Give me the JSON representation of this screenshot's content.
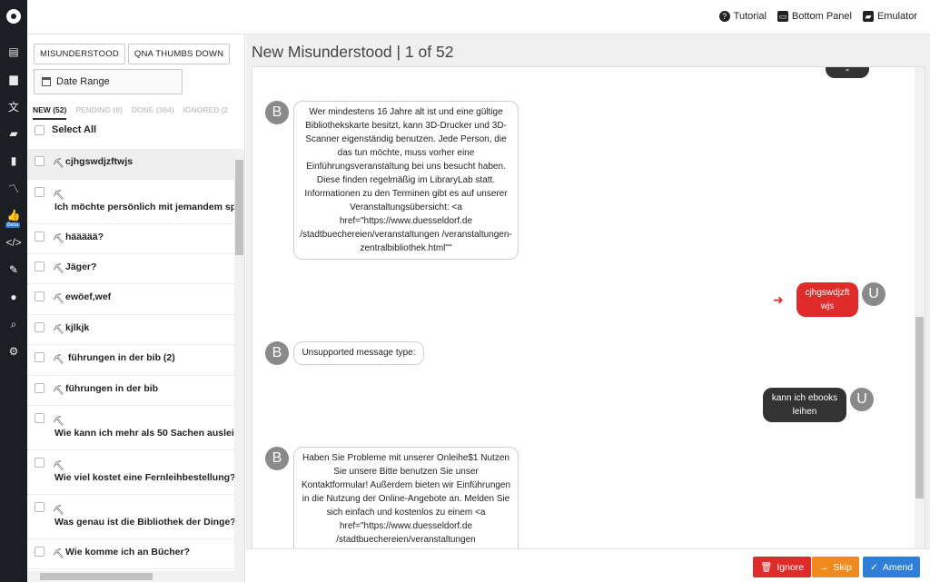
{
  "toolbar": {
    "tutorial": "Tutorial",
    "bottom_panel": "Bottom Panel",
    "emulator": "Emulator"
  },
  "filters": {
    "misunderstood": "MISUNDERSTOOD",
    "qna_thumbs_down": "QNA THUMBS DOWN",
    "date_range": "Date Range"
  },
  "tabs": [
    {
      "label": "NEW (52)",
      "active": true
    },
    {
      "label": "PENDING (0)"
    },
    {
      "label": "DONE (304)"
    },
    {
      "label": "IGNORED (2"
    }
  ],
  "select_all": "Select All",
  "items": [
    "cjhgswdjzftwjs",
    "Ich möchte persönlich mit jemandem sp",
    "häääää?",
    "Jäger?",
    "ewöef,wef",
    "kjlkjk",
    " führungen in der bib (2)",
    "führungen in der bib",
    "Wie kann ich mehr als 50 Sachen auslei",
    "Wie viel kostet eine Fernleihbestellung?",
    "Was genau ist die Bibliothek der Dinge?",
    "Wie komme ich an Bücher?"
  ],
  "title": "New Misunderstood | 1 of 52",
  "chat": {
    "top_partial": "\"",
    "bot1": "Wer mindestens 16 Jahre alt ist und eine gültige Bibliothekskarte besitzt, kann 3D-Drucker und 3D-Scanner eigenständig benutzen. Jede Person, die das tun möchte, muss vorher eine Einführungsveranstaltung bei uns besucht haben. Diese finden regelmäßig im LibraryLab statt. Informationen zu den Terminen gibt es auf unserer Veranstaltungsübersicht: <a href=\"https://www.duesseldorf.de /stadtbuechereien/veranstaltungen /veranstaltungen-zentralbibliothek.html\"\"",
    "user1": "cjhgswdjzft wjs",
    "bot2": "Unsupported message type:",
    "user2": "kann ich ebooks leihen",
    "bot3": "Haben Sie Probleme mit unserer Onleihe$1 Nutzen Sie unsere Bitte benutzen Sie unser Kontaktformular! Außerdem bieten wir Einführungen in die Nutzung der Online-Angebote an. Melden Sie sich einfach und kostenlos zu einem <a href=\"https://www.duesseldorf.de /stadtbuechereien/veranstaltungen",
    "bot_avatar": "B",
    "user_avatar": "U"
  },
  "actions": {
    "ignore": "Ignore",
    "skip": "Skip",
    "amend": "Amend"
  },
  "colors": {
    "ignore": "#e02b2b",
    "skip": "#ef8a1f",
    "amend": "#2f7fd6",
    "rail": "#1b1e22"
  }
}
